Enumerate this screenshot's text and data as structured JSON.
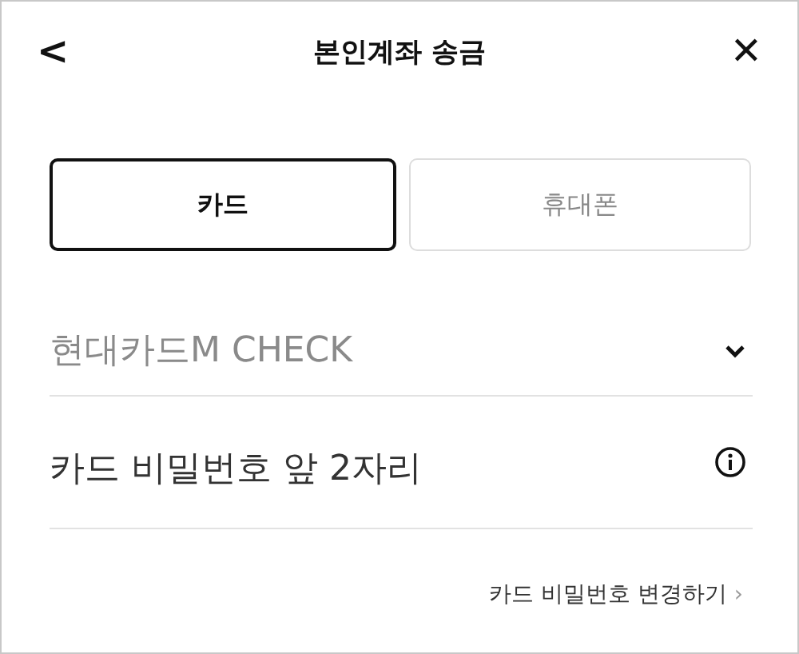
{
  "header": {
    "back": "<",
    "title": "본인계좌 송금",
    "close": "✕"
  },
  "tabs": [
    {
      "label": "카드",
      "selected": true
    },
    {
      "label": "휴대폰",
      "selected": false
    }
  ],
  "card_select": {
    "value": "현대카드M CHECK"
  },
  "password_field": {
    "placeholder": "카드 비밀번호 앞 2자리"
  },
  "change_link": {
    "label": "카드 비밀번호 변경하기",
    "chevron": "›"
  }
}
